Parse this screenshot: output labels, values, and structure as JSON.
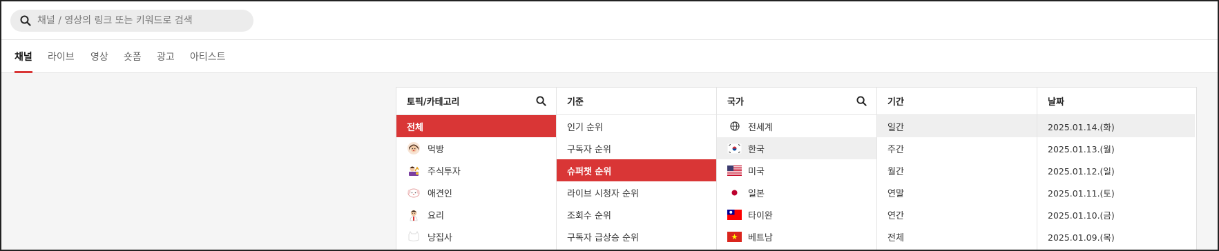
{
  "search": {
    "placeholder": "채널 / 영상의 링크 또는 키워드로 검색",
    "icon": "search-icon"
  },
  "tabs": [
    {
      "label": "채널",
      "active": true
    },
    {
      "label": "라이브",
      "active": false
    },
    {
      "label": "영상",
      "active": false
    },
    {
      "label": "숏폼",
      "active": false
    },
    {
      "label": "광고",
      "active": false
    },
    {
      "label": "아티스트",
      "active": false
    }
  ],
  "accent_color": "#d93636",
  "columns": {
    "topic": {
      "header": "토픽/카테고리",
      "items": [
        {
          "label": "전체",
          "selected": true
        },
        {
          "label": "먹방",
          "icon": "person-eating-icon"
        },
        {
          "label": "주식투자",
          "icon": "stock-investment-icon"
        },
        {
          "label": "애견인",
          "icon": "dog-icon"
        },
        {
          "label": "요리",
          "icon": "chef-icon"
        },
        {
          "label": "냥집사",
          "icon": "cat-icon"
        }
      ]
    },
    "criteria": {
      "header": "기준",
      "items": [
        {
          "label": "인기 순위"
        },
        {
          "label": "구독자 순위"
        },
        {
          "label": "슈퍼챗 순위",
          "selected": true
        },
        {
          "label": "라이브 시청자 순위"
        },
        {
          "label": "조회수 순위"
        },
        {
          "label": "구독자 급상승 순위"
        }
      ]
    },
    "country": {
      "header": "국가",
      "items": [
        {
          "label": "전세계",
          "icon": "globe-icon"
        },
        {
          "label": "한국",
          "icon": "flag-kr-icon",
          "hover": true
        },
        {
          "label": "미국",
          "icon": "flag-us-icon"
        },
        {
          "label": "일본",
          "icon": "flag-jp-icon"
        },
        {
          "label": "타이완",
          "icon": "flag-tw-icon"
        },
        {
          "label": "베트남",
          "icon": "flag-vn-icon"
        }
      ]
    },
    "period": {
      "header": "기간",
      "items": [
        {
          "label": "일간",
          "hover": true
        },
        {
          "label": "주간"
        },
        {
          "label": "월간"
        },
        {
          "label": "연말"
        },
        {
          "label": "연간"
        },
        {
          "label": "전체"
        }
      ]
    },
    "date": {
      "header": "날짜",
      "items": [
        {
          "label": "2025.01.14.(화)",
          "hover": true
        },
        {
          "label": "2025.01.13.(월)"
        },
        {
          "label": "2025.01.12.(일)"
        },
        {
          "label": "2025.01.11.(토)"
        },
        {
          "label": "2025.01.10.(금)"
        },
        {
          "label": "2025.01.09.(목)"
        }
      ]
    }
  }
}
